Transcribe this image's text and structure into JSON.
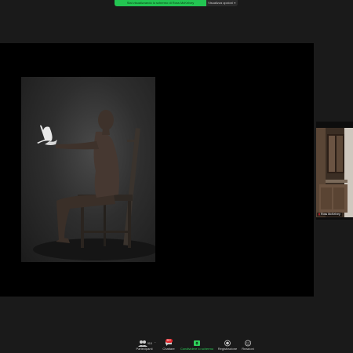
{
  "banner": {
    "sharing_text": "Stai visualizzando lo schermo di Ross McKelvey",
    "view_options_label": "Visualizza opzioni",
    "accent": "#23c552"
  },
  "participant": {
    "name": "Ross McKelvey"
  },
  "toolbar": {
    "participants_label": "Partecipanti",
    "participants_count": "918",
    "chat_label": "Chattare",
    "chat_badge": "99+",
    "share_label": "Condividere lo schermo",
    "record_label": "Registrazione",
    "reactions_label": "Reazioni",
    "share_color": "#2fd05a"
  },
  "icons": [
    "people-icon",
    "chat-icon",
    "share-screen-icon",
    "record-icon",
    "reactions-icon",
    "microphone-muted-icon",
    "chevron-down-icon"
  ]
}
